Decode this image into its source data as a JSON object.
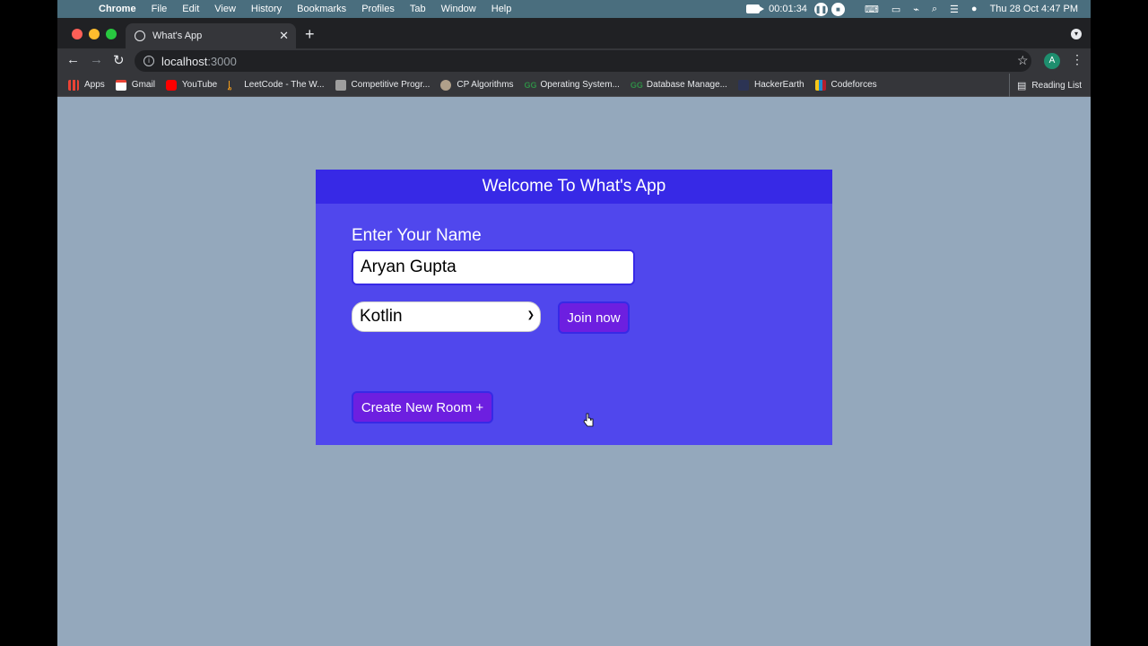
{
  "os_menubar": {
    "app": "Chrome",
    "items": [
      "File",
      "Edit",
      "View",
      "History",
      "Bookmarks",
      "Profiles",
      "Tab",
      "Window",
      "Help"
    ],
    "recording_time": "00:01:34",
    "datetime": "Thu 28 Oct  4:47 PM"
  },
  "browser": {
    "tab_title": "What's App",
    "url_host": "localhost",
    "url_port": ":3000",
    "profile_initial": "A",
    "bookmarks": [
      {
        "label": "Apps",
        "icon": "apps-grid-icon",
        "color": "#ea4335"
      },
      {
        "label": "Gmail",
        "icon": "gmail-icon",
        "color": "#ea4335"
      },
      {
        "label": "YouTube",
        "icon": "youtube-icon",
        "color": "#ff0000"
      },
      {
        "label": "LeetCode - The W...",
        "icon": "leetcode-icon",
        "color": "#f89f1b"
      },
      {
        "label": "Competitive Progr...",
        "icon": "codechef-icon",
        "color": "#9e9e9e"
      },
      {
        "label": "CP Algorithms",
        "icon": "cp-algorithms-icon",
        "color": "#b0a08a"
      },
      {
        "label": "Operating System...",
        "icon": "gfg-icon",
        "color": "#2f8d46"
      },
      {
        "label": "Database Manage...",
        "icon": "gfg-icon",
        "color": "#2f8d46"
      },
      {
        "label": "HackerEarth",
        "icon": "hackerearth-icon",
        "color": "#2c3454"
      },
      {
        "label": "Codeforces",
        "icon": "codeforces-icon",
        "color": "#1f8acb"
      }
    ],
    "reading_list": "Reading List"
  },
  "page": {
    "header": "Welcome To What's App",
    "name_label": "Enter Your Name",
    "name_value": "Aryan Gupta",
    "room_selected": "Kotlin",
    "join_label": "Join now",
    "create_label": "Create New Room +"
  },
  "colors": {
    "page_bg": "#94a8bc",
    "card_bg": "#5047ed",
    "header_bg": "#3729e6",
    "button_bg": "#6d1fe0"
  }
}
